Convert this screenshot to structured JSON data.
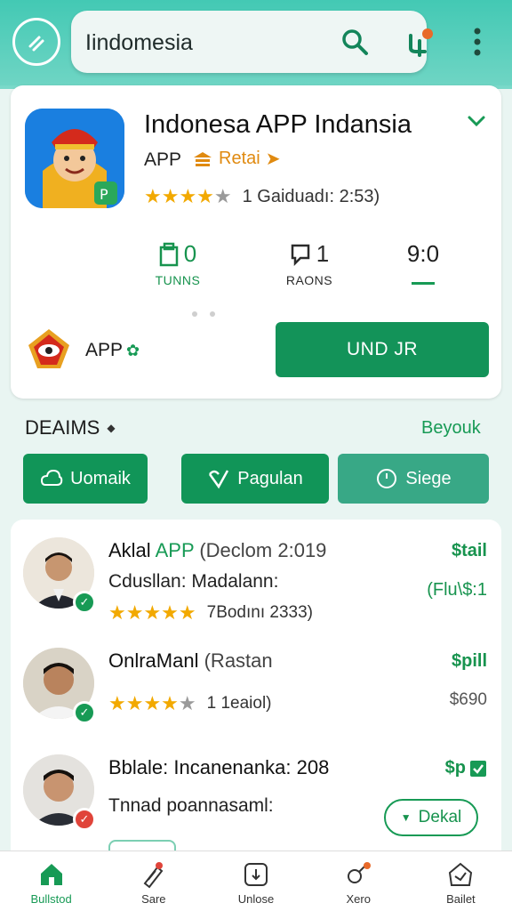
{
  "search": {
    "query": "Iindomesia"
  },
  "app": {
    "title": "Indonesa APP Indansia",
    "category": "APP",
    "tag": "Retai",
    "rating_stars": 4,
    "rating_text": "1 Gaiduadı: 2:53)",
    "stats": [
      {
        "value": "0",
        "label": "TUNNS"
      },
      {
        "value": "1",
        "label": "RAONS"
      },
      {
        "value": "9:0",
        "label": ""
      }
    ],
    "developer": "APP",
    "install_label": "UND JR"
  },
  "section": {
    "title": "DEAIMS",
    "link": "Beyouk",
    "chips": [
      "Uomaik",
      "Pagulan",
      "Siege"
    ]
  },
  "reviews": [
    {
      "name": "Aklal",
      "name_accent": "APP",
      "name_muted": "(Declom 2:019",
      "subtitle": "Cdusllan: Madalann:",
      "stars": 5,
      "rating_text": "7Bodını 2333)",
      "price": "$tail",
      "price2": "(Flu\\$:1"
    },
    {
      "name": "OnlraManl",
      "name_muted": "(Rastan",
      "stars": 4,
      "rating_text": "1 1eaiol)",
      "price": "$pill",
      "price2": "$690"
    },
    {
      "name": "Bblale: Incanenanka: 208",
      "subtitle": "Tnnad poannasaml:",
      "price": "$p",
      "button": "Dekal"
    }
  ],
  "nav": [
    {
      "label": "Bullstod",
      "active": true
    },
    {
      "label": "Sare",
      "active": false
    },
    {
      "label": "Unlose",
      "active": false
    },
    {
      "label": "Xero",
      "active": false
    },
    {
      "label": "Bailet",
      "active": false
    }
  ],
  "colors": {
    "accent": "#139359",
    "topbar": "#43c9b4",
    "star": "#f2a900"
  }
}
